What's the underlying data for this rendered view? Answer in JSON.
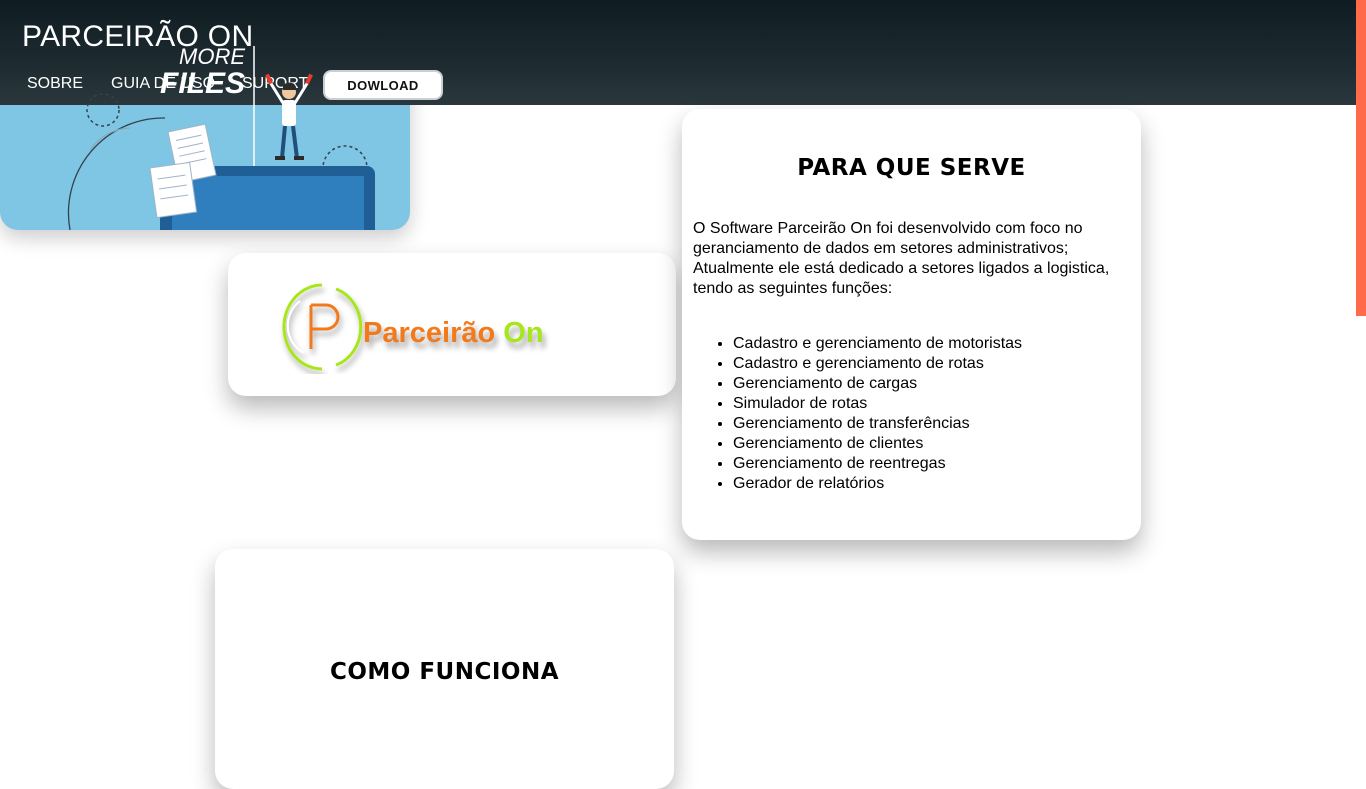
{
  "header": {
    "title": "PARCEIRÃO ON",
    "nav": {
      "sobre": "SOBRE",
      "guia": "GUIA DE USO",
      "suport": "SUPORT",
      "download": "DOWLOAD"
    }
  },
  "logo": {
    "word1": "Parceirão",
    "word2": "On",
    "letter": "P"
  },
  "serve": {
    "title": "PARA QUE SERVE",
    "intro": "O Software Parceirão On foi desenvolvido com foco no geranciamento de dados em setores administrativos; Atualmente ele está dedicado a setores ligados a logistica, tendo as seguintes funções:",
    "items": [
      "Cadastro e gerenciamento de motoristas",
      "Cadastro e gerenciamento de rotas",
      "Gerenciamento de cargas",
      "Simulador de rotas",
      "Gerenciamento de transferências",
      "Gerenciamento de clientes",
      "Gerenciamento de reentregas",
      "Gerador de relatórios"
    ]
  },
  "como": {
    "title": "COMO FUNCIONA"
  },
  "illustration": {
    "line1": "MORE",
    "line2": "FILES"
  },
  "colors": {
    "header_top": "#0f1c22",
    "accent_scroll": "#ff6a4a",
    "illustration_bg": "#7fc6e4",
    "logo_orange": "#f27a1a",
    "logo_green": "#a8e61c"
  }
}
